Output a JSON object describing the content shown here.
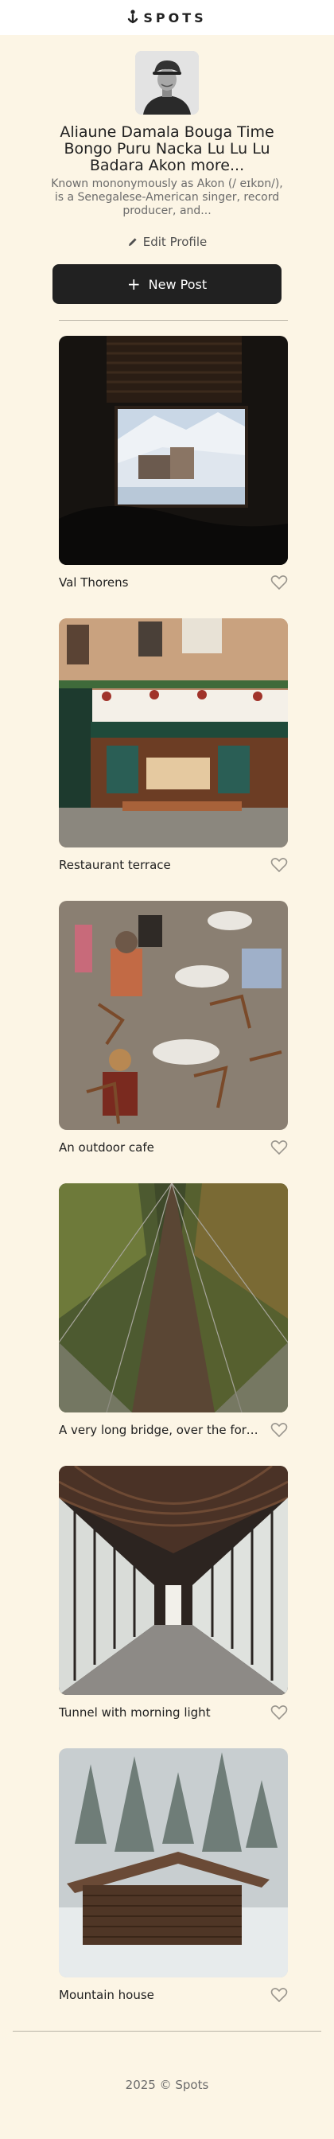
{
  "header": {
    "logo_text": "SPOTS",
    "logo_icon": "spots-logo-icon"
  },
  "profile": {
    "name": "Aliaune Damala Bouga Time Bongo Puru Nacka Lu Lu Lu Badara Akon more...",
    "bio": "Known mononymously as Akon (/ eɪkɒn/), is a Senegalese-American singer, record producer, and...",
    "edit_label": "Edit Profile",
    "new_post_label": "New Post"
  },
  "cards": [
    {
      "title": "Val Thorens",
      "liked": false
    },
    {
      "title": "Restaurant terrace",
      "liked": false
    },
    {
      "title": "An outdoor cafe",
      "liked": false
    },
    {
      "title": "A very long bridge, over the forest and through the trees",
      "liked": false
    },
    {
      "title": "Tunnel with morning light",
      "liked": false
    },
    {
      "title": "Mountain house",
      "liked": false
    }
  ],
  "footer": {
    "text": "2025 © Spots"
  },
  "colors": {
    "background": "#fcf5e5",
    "button": "#212121",
    "text": "#212121",
    "muted": "#6b6b6b"
  }
}
